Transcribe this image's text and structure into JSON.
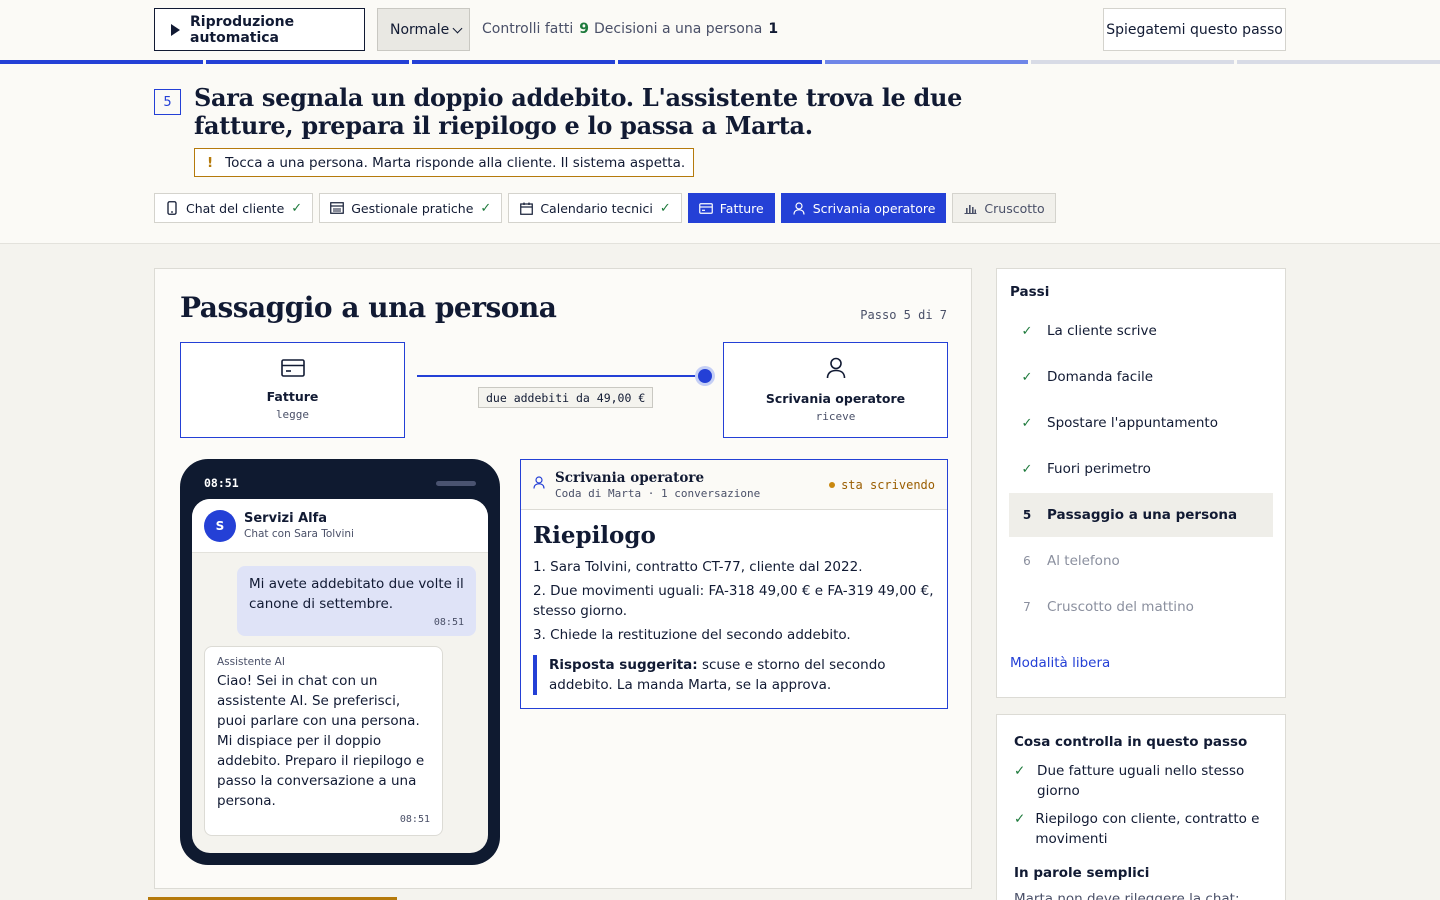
{
  "toolbar": {
    "autoplay_label": "Riproduzione automatica",
    "speed_value": "Normale",
    "stat_checks_label": "Controlli fatti",
    "stat_checks_value": "9",
    "stat_handoffs_label": "Decisioni a una persona",
    "stat_handoffs_value": "1",
    "explain_label": "Spiegatemi questo passo"
  },
  "progress": {
    "total_segments": 7,
    "done_segments": 4,
    "current_segment": 5
  },
  "step": {
    "number": "5",
    "title": "Sara segnala un doppio addebito. L'assistente trova le due fatture, prepara il riepilogo e lo passa a Marta.",
    "alert_icon": "!",
    "alert_text": "Tocca a una persona. Marta risponde alla cliente. Il sistema aspetta."
  },
  "tabs": [
    {
      "label": "Chat del cliente",
      "icon": "phone-icon",
      "state": "done"
    },
    {
      "label": "Gestionale pratiche",
      "icon": "table-icon",
      "state": "done"
    },
    {
      "label": "Calendario tecnici",
      "icon": "calendar-icon",
      "state": "done"
    },
    {
      "label": "Fatture",
      "icon": "card-icon",
      "state": "active"
    },
    {
      "label": "Scrivania operatore",
      "icon": "person-icon",
      "state": "active"
    },
    {
      "label": "Cruscotto",
      "icon": "chart-icon",
      "state": "muted"
    }
  ],
  "main": {
    "title": "Passaggio a una persona",
    "step_counter": "Passo 5 di 7",
    "flow": {
      "from_label": "Fatture",
      "from_sub": "legge",
      "to_label": "Scrivania operatore",
      "to_sub": "riceve",
      "connector_label": "due addebiti da 49,00 €"
    }
  },
  "phone": {
    "time": "08:51",
    "contact_initial": "S",
    "contact_name": "Servizi Alfa",
    "contact_sub": "Chat con Sara Tolvini",
    "user_message": "Mi avete addebitato due volte il canone di settembre.",
    "user_time": "08:51",
    "ai_sender": "Assistente AI",
    "ai_message": "Ciao! Sei in chat con un assistente AI. Se preferisci, puoi parlare con una persona. Mi dispiace per il doppio addebito. Preparo il riepilogo e passo la conversazione a una persona.",
    "ai_time": "08:51"
  },
  "operator": {
    "title": "Scrivania operatore",
    "sub": "Coda di Marta · 1 conversazione",
    "status": "sta scrivendo",
    "summary_title": "Riepilogo",
    "lines": [
      "1. Sara Tolvini, contratto CT-77, cliente dal 2022.",
      "2. Due movimenti uguali: FA-318 49,00 € e FA-319 49,00 €, stesso giorno.",
      "3. Chiede la restituzione del secondo addebito."
    ],
    "suggest_label": "Risposta suggerita:",
    "suggest_text": " scuse e storno del secondo addebito. La manda Marta, se la approva."
  },
  "sidebar": {
    "heading": "Passi",
    "steps": [
      {
        "mark": "✓",
        "label": "La cliente scrive",
        "state": "done"
      },
      {
        "mark": "✓",
        "label": "Domanda facile",
        "state": "done"
      },
      {
        "mark": "✓",
        "label": "Spostare l'appuntamento",
        "state": "done"
      },
      {
        "mark": "✓",
        "label": "Fuori perimetro",
        "state": "done"
      },
      {
        "mark": "5",
        "label": "Passaggio a una persona",
        "state": "current"
      },
      {
        "mark": "6",
        "label": "Al telefono",
        "state": "future"
      },
      {
        "mark": "7",
        "label": "Cruscotto del mattino",
        "state": "future"
      }
    ],
    "free_mode": "Modalità libera"
  },
  "checks": {
    "heading": "Cosa controlla in questo passo",
    "items": [
      "Due fatture uguali nello stesso giorno",
      "Riepilogo con cliente, contratto e movimenti"
    ],
    "plain_heading": "In parole semplici",
    "plain_text": "Marta non deve rileggere la chat: trova"
  },
  "colors": {
    "accent": "#2440d6",
    "success": "#1e7a3c",
    "warning": "#b57a0c",
    "ink": "#111a33"
  }
}
